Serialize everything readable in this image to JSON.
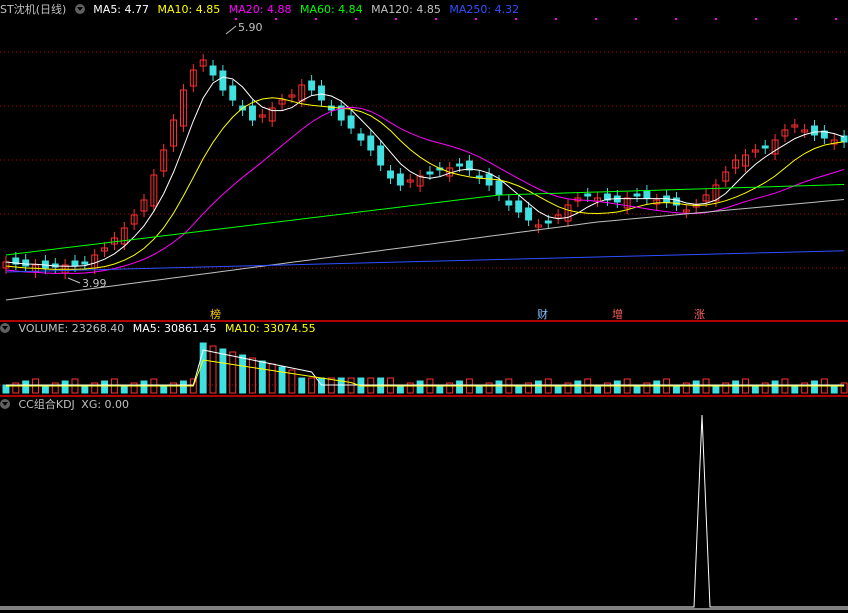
{
  "main": {
    "title": "ST沈机(日线)",
    "ma": [
      {
        "label": "MA5: 4.77",
        "color": "#ffffff"
      },
      {
        "label": "MA10: 4.85",
        "color": "#ffff00"
      },
      {
        "label": "MA20: 4.88",
        "color": "#ff00ff"
      },
      {
        "label": "MA60: 4.84",
        "color": "#00ff00"
      },
      {
        "label": "MA120: 4.85",
        "color": "#c0c0c0"
      },
      {
        "label": "MA250: 4.32",
        "color": "#3050ff"
      }
    ],
    "high_label": "5.90",
    "low_label": "3.99",
    "events": [
      {
        "text": "榜",
        "color": "#ffcc00"
      },
      {
        "text": "财",
        "color": "#80c0ff"
      },
      {
        "text": "增",
        "color": "#ff6060"
      },
      {
        "text": "涨",
        "color": "#ff6060"
      }
    ]
  },
  "volume": {
    "title": "VOLUME: 23268.40",
    "ma5": "MA5: 30861.45",
    "ma10": "MA10: 33074.55"
  },
  "kdj": {
    "title": "CC组合KDJ",
    "xg": "XG: 0.00"
  },
  "colors": {
    "up": "#ff3030",
    "down": "#40e0e0",
    "grid": "#b00000"
  }
}
